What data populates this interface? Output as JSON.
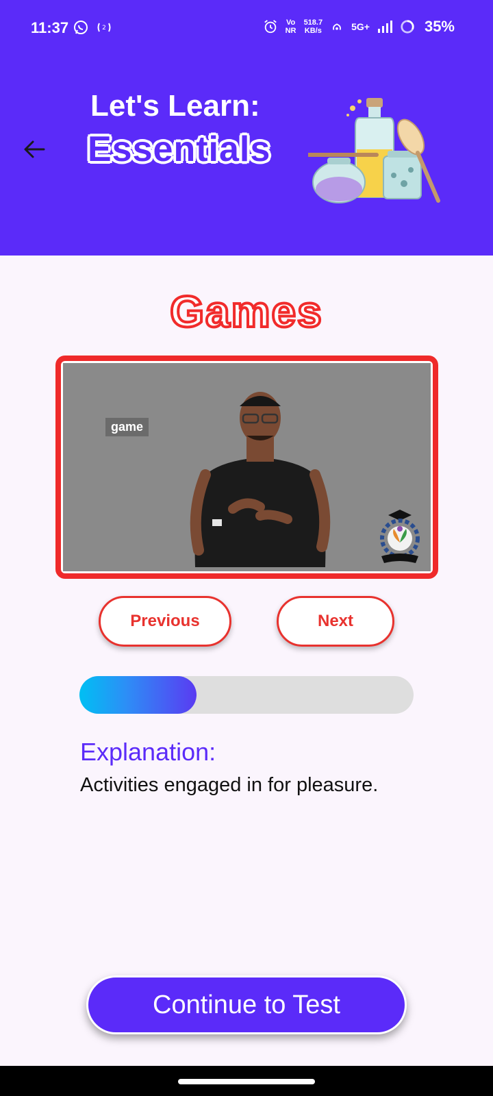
{
  "status_bar": {
    "time": "11:37",
    "network_speed_value": "518.7",
    "network_speed_unit": "KB/s",
    "volte": "Vo NR",
    "network_type": "5G+",
    "battery": "35%"
  },
  "header": {
    "title_small": "Let's Learn:",
    "title_big": "Essentials",
    "background_color": "#5b2bf9"
  },
  "lesson": {
    "section_title": "Games",
    "video_caption": "game",
    "previous_label": "Previous",
    "next_label": "Next",
    "progress_fraction": 0.35,
    "explanation_heading": "Explanation:",
    "explanation_text": "Activities engaged in for pleasure."
  },
  "footer": {
    "continue_label": "Continue to Test"
  }
}
